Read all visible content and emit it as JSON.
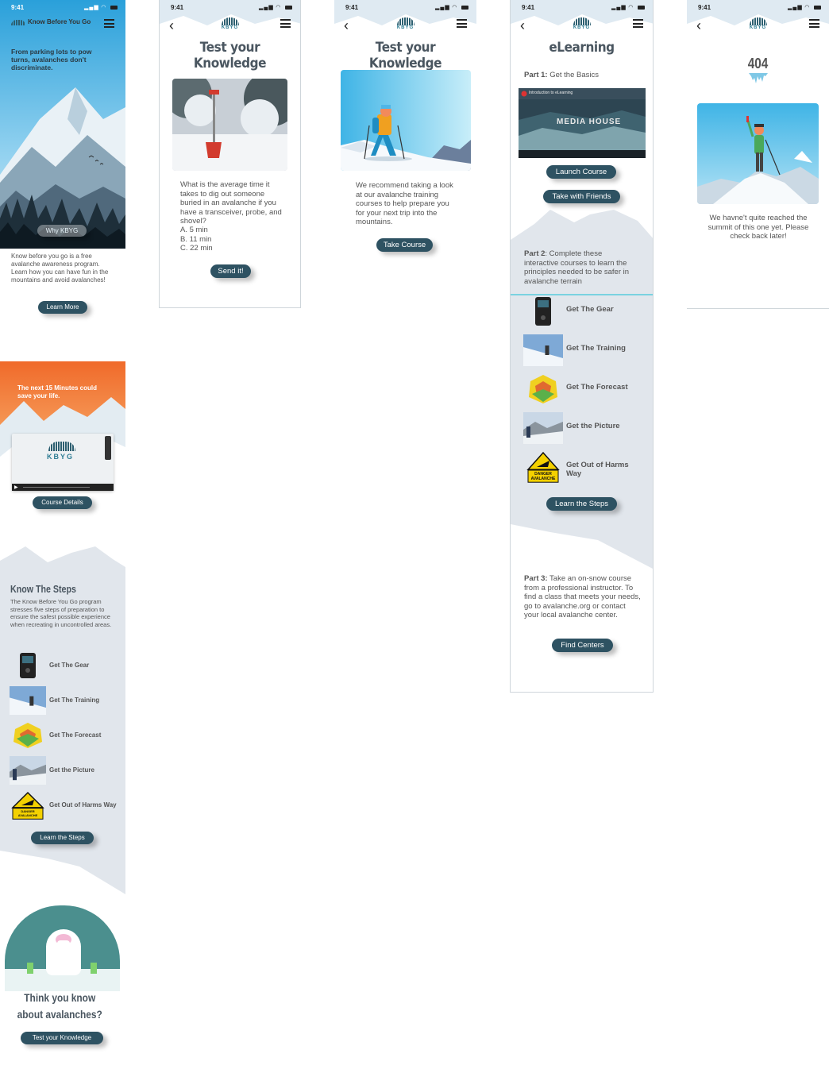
{
  "screen1": {
    "app_title": "Know Before You Go",
    "hero_text": "From parking lots to pow turns, avalanches don't discriminate.",
    "why_button": "Why KBYG",
    "intro": "Know before you go is a free avalanche awareness program. Learn how you can have fun in the mountains and avoid avalanches!",
    "learn_more_button": "Learn More",
    "video_heading": "The next 15 Minutes could save your life.",
    "video_logo": "KBYG",
    "course_details_button": "Course Details",
    "steps_heading": "Know The Steps",
    "steps_intro": "The Know Before You Go program stresses five steps of preparation to ensure the safest possible experience when recreating in uncontrolled areas.",
    "steps": [
      "Get The Gear",
      "Get The Training",
      "Get The Forecast",
      "Get the Picture",
      "Get Out of Harms Way"
    ],
    "learn_steps_button": "Learn the Steps",
    "quiz_heading": "Think you know about avalanches?",
    "quiz_button": "Test your Knowledge"
  },
  "status": {
    "time": "9:41"
  },
  "logo_text": "KBYG",
  "screen2": {
    "title": "Test your Knowledge",
    "question": "What is the average time it takes to dig out someone buried in an avalanche if you have a transceiver, probe, and shovel?",
    "options": [
      "A. 5 min",
      "B. 11 min",
      "C. 22 min"
    ],
    "send_button": "Send it!"
  },
  "screen3": {
    "title": "Test your Knowledge",
    "text": "We recommend taking a look at our avalanche training courses to help prepare you for your next trip into the mountains.",
    "button": "Take Course"
  },
  "screen4": {
    "title": "eLearning",
    "part1_label": "Part 1:",
    "part1_text": " Get the Basics",
    "video_title": "Introduction to eLearning",
    "video_brand": "MEDIA HOUSE",
    "launch_button": "Launch Course",
    "friends_button": "Take with Friends",
    "part2_label": "Part 2",
    "part2_text": ": Complete these interactive courses to learn the principles needed to be safer in avalanche terrain",
    "steps": [
      "Get The Gear",
      "Get The Training",
      "Get The Forecast",
      "Get the Picture",
      "Get Out of Harms Way"
    ],
    "learn_steps_button": "Learn the Steps",
    "part3_label": "Part 3:",
    "part3_text": " Take an on-snow course from a professional instructor. To find a class that meets your needs, go to avalanche.org or contact your local avalanche center.",
    "find_button": "Find Centers"
  },
  "screen5": {
    "code": "404",
    "message": "We havne't quite reached the summit of this one yet. Please check back later!"
  },
  "icons": {
    "danger_sign_text": "DANGER AVALANCHE"
  },
  "colors": {
    "button": "#2e5262",
    "accent_teal": "#2e7d94",
    "sky": "#3fb4e6",
    "orange": "#f06a2a"
  }
}
